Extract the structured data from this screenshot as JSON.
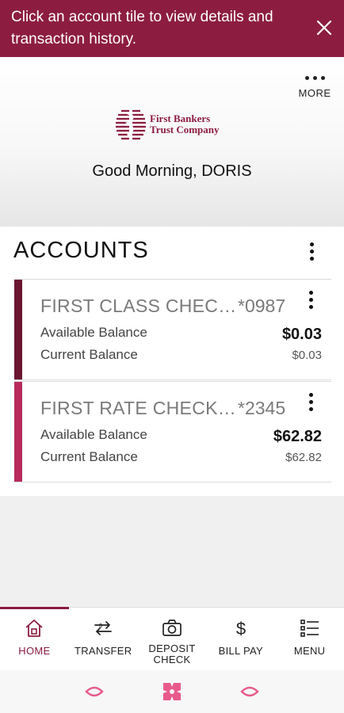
{
  "banner": {
    "message": "Click an account tile to view details and transaction history."
  },
  "header": {
    "more_label": "MORE",
    "logo_line1": "First Bankers",
    "logo_line2": "Trust Company",
    "greeting": "Good Morning, DORIS"
  },
  "accounts": {
    "title": "ACCOUNTS",
    "items": [
      {
        "name": "FIRST CLASS CHECKING",
        "number": "*0987",
        "available_label": "Available Balance",
        "available_value": "$0.03",
        "current_label": "Current Balance",
        "current_value": "$0.03",
        "stripe_color": "#6b1530"
      },
      {
        "name": "FIRST RATE CHECKING",
        "number": "*2345",
        "available_label": "Available Balance",
        "available_value": "$62.82",
        "current_label": "Current Balance",
        "current_value": "$62.82",
        "stripe_color": "#b82a5c"
      }
    ]
  },
  "nav": {
    "items": [
      {
        "label": "HOME",
        "icon": "home-icon",
        "active": true
      },
      {
        "label": "TRANSFER",
        "icon": "transfer-icon"
      },
      {
        "label": "DEPOSIT CHECK",
        "icon": "camera-icon"
      },
      {
        "label": "BILL PAY",
        "icon": "dollar-icon"
      },
      {
        "label": "MENU",
        "icon": "menu-list-icon"
      }
    ]
  },
  "colors": {
    "brand": "#8c1d40",
    "system_icons": "#e85a8c"
  }
}
